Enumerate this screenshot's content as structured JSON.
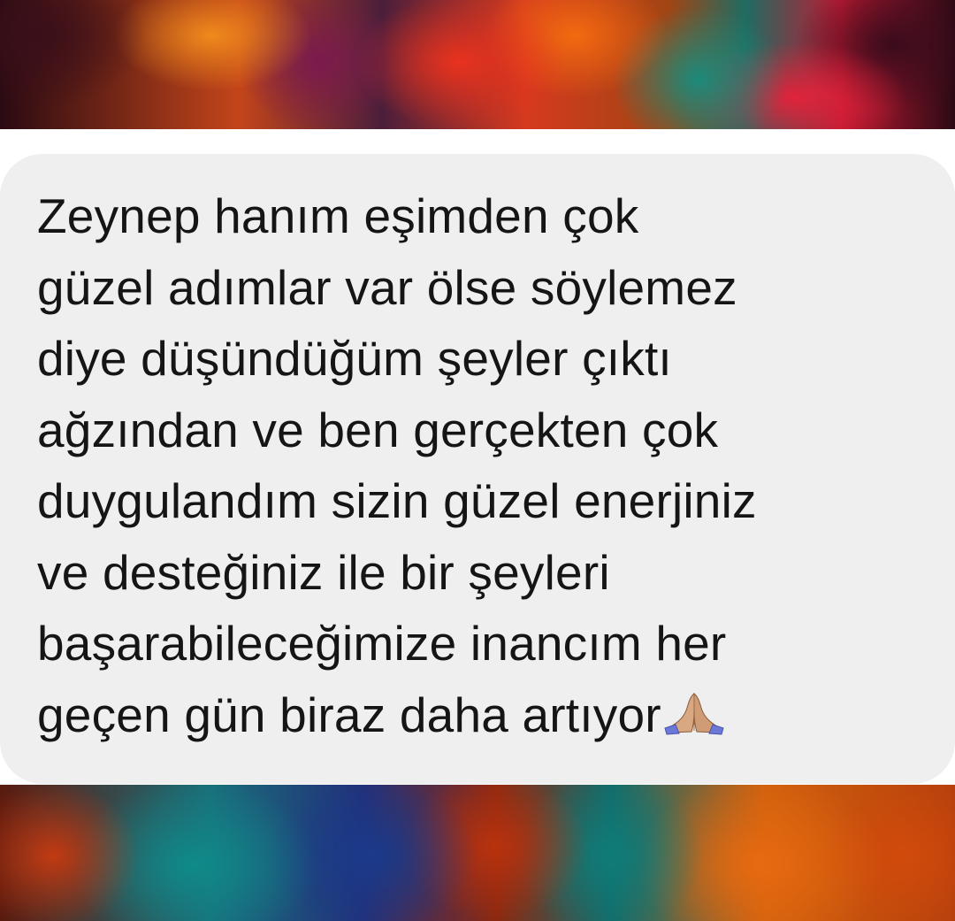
{
  "message": {
    "lines": [
      "Zeynep hanım eşimden çok",
      "güzel adımlar var ölse söylemez",
      "diye düşündüğüm şeyler çıktı",
      "ağzından ve ben gerçekten çok",
      "duygulandım sizin güzel enerjiniz",
      "ve desteğiniz ile bir şeyleri",
      "başarabileceğimize inancım her",
      "geçen gün biraz daha artıyor"
    ],
    "emoji": "folded-hands-icon"
  },
  "colors": {
    "bubble_background": "#efeff0",
    "text": "#151515",
    "band": "#ffffff"
  }
}
